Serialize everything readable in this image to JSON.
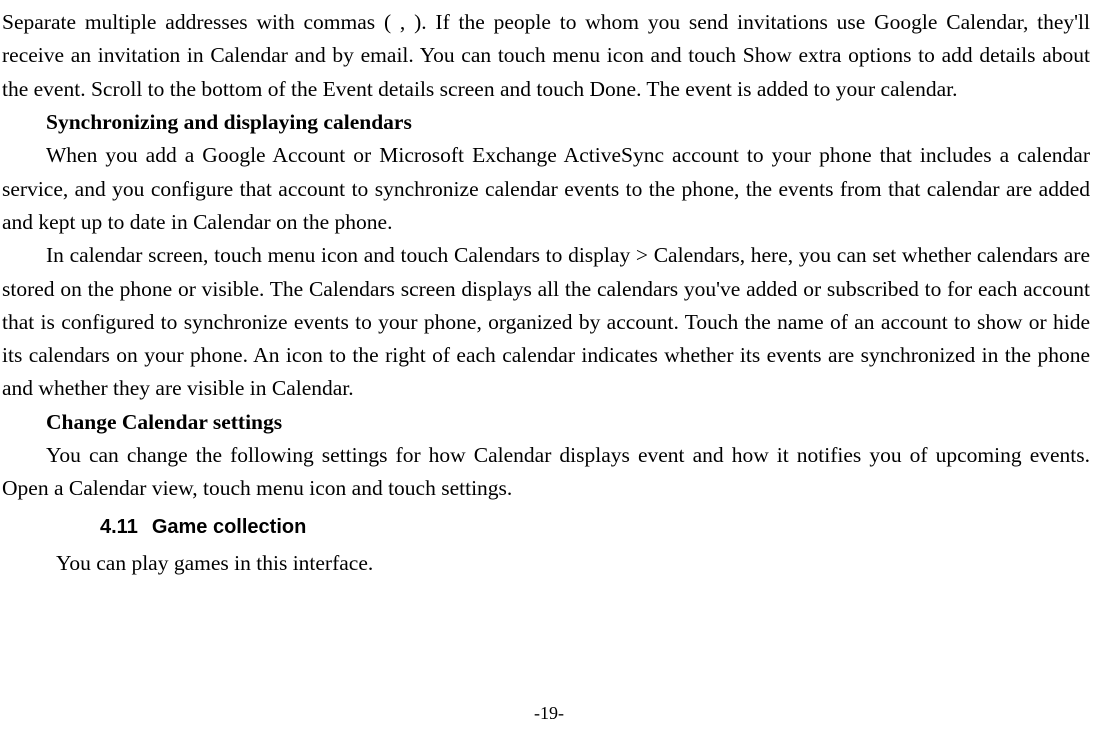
{
  "para_intro": "Separate multiple addresses with commas ( , ). If the people to whom you send invitations use Google Calendar, they'll receive an invitation in Calendar and by email. You can touch menu icon and touch Show extra options to add details about the event. Scroll to the bottom of the Event details screen and touch Done. The event is added to your calendar.",
  "heading_sync": "Synchronizing and displaying calendars",
  "para_sync1": "When you add a Google Account or Microsoft Exchange ActiveSync account to your phone that includes a calendar service, and you configure that account to synchronize calendar events to the phone, the events from that calendar are added and kept up to date in Calendar on the phone.",
  "para_sync2": "In calendar screen, touch menu icon and touch Calendars to display > Calendars, here, you can set whether calendars are stored on the phone or visible. The Calendars screen displays all the calendars you've added or subscribed to for each account that is configured to synchronize events to your phone, organized by account. Touch the name of an account to show or hide its calendars on your phone. An icon to the right of each calendar indicates whether its events are synchronized in the phone and whether they are visible in Calendar.",
  "heading_change": "Change Calendar settings",
  "para_change": "You can change the following settings for how Calendar displays event and how it notifies you of upcoming events. Open a Calendar view, touch menu icon and touch settings.",
  "section_number": "4.11",
  "section_title": "Game collection",
  "para_game": "You can play games in this interface.",
  "page_number": "-19-"
}
